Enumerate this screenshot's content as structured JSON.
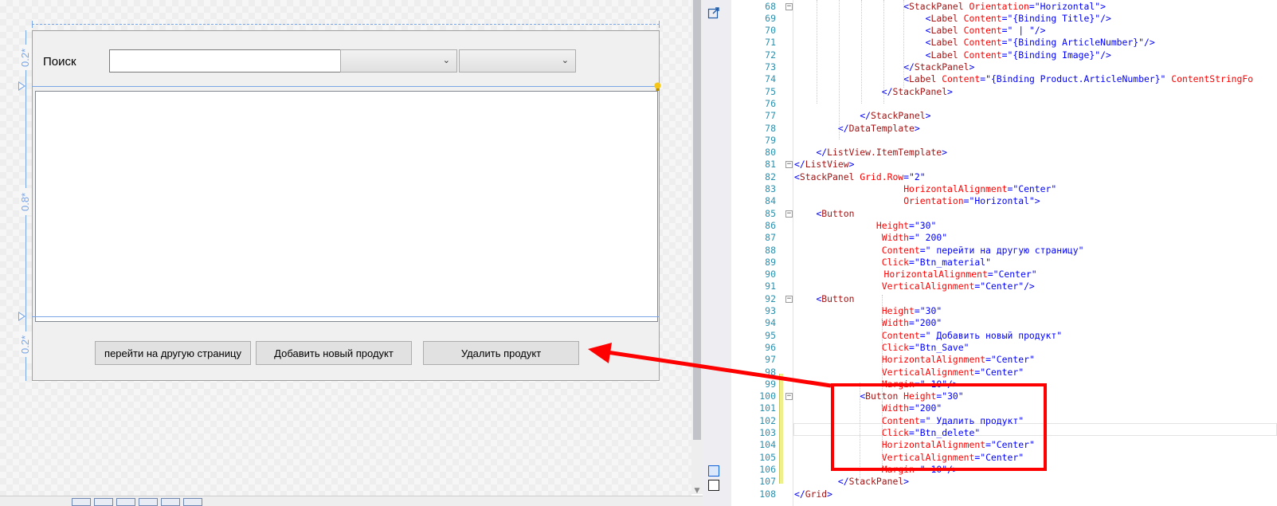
{
  "designer": {
    "row_labels": [
      "0.2*",
      "0.8*",
      "0.2*"
    ],
    "search_label": "Поиск",
    "search_input_value": "",
    "combo_1_value": "",
    "combo_2_value": "",
    "buttons": [
      "перейти на другую страницу",
      "Добавить новый продукт",
      "Удалить продукт"
    ],
    "icons": {
      "chevron": "⌄"
    }
  },
  "editor": {
    "lines": [
      {
        "n": 68,
        "tokens": [
          [
            "d",
            "<"
          ],
          [
            "e",
            "StackPanel"
          ],
          [
            "a",
            " Orientation"
          ],
          [
            "d",
            "=\""
          ],
          [
            "v",
            "Horizontal"
          ],
          [
            "d",
            "\">"
          ]
        ]
      },
      {
        "n": 69,
        "tokens": [
          [
            "d",
            "<"
          ],
          [
            "e",
            "Label"
          ],
          [
            "a",
            " Content"
          ],
          [
            "d",
            "=\""
          ],
          [
            "v",
            "{Binding Title}"
          ],
          [
            "d",
            "\"/>"
          ]
        ]
      },
      {
        "n": 70,
        "tokens": [
          [
            "d",
            "<"
          ],
          [
            "e",
            "Label"
          ],
          [
            "a",
            " Content"
          ],
          [
            "d",
            "=\""
          ],
          [
            "v",
            " | "
          ],
          [
            "d",
            "\"/>"
          ]
        ]
      },
      {
        "n": 71,
        "tokens": [
          [
            "d",
            "<"
          ],
          [
            "e",
            "Label"
          ],
          [
            "a",
            " Content"
          ],
          [
            "d",
            "=\""
          ],
          [
            "v",
            "{Binding ArticleNumber}"
          ],
          [
            "d",
            "\"/>"
          ]
        ]
      },
      {
        "n": 72,
        "tokens": [
          [
            "d",
            "<"
          ],
          [
            "e",
            "Label"
          ],
          [
            "a",
            " Content"
          ],
          [
            "d",
            "=\""
          ],
          [
            "v",
            "{Binding Image}"
          ],
          [
            "d",
            "\"/>"
          ]
        ]
      },
      {
        "n": 73,
        "tokens": [
          [
            "d",
            "</"
          ],
          [
            "e",
            "StackPanel"
          ],
          [
            "d",
            ">"
          ]
        ]
      },
      {
        "n": 74,
        "tokens": [
          [
            "d",
            "<"
          ],
          [
            "e",
            "Label"
          ],
          [
            "a",
            " Content"
          ],
          [
            "d",
            "=\""
          ],
          [
            "v",
            "{Binding Product.ArticleNumber}"
          ],
          [
            "d",
            "\""
          ],
          [
            "a",
            " ContentStringFo"
          ]
        ]
      },
      {
        "n": 75,
        "tokens": [
          [
            "d",
            "</"
          ],
          [
            "e",
            "StackPanel"
          ],
          [
            "d",
            ">"
          ]
        ]
      },
      {
        "n": 76,
        "tokens": []
      },
      {
        "n": 77,
        "tokens": [
          [
            "d",
            "</"
          ],
          [
            "e",
            "StackPanel"
          ],
          [
            "d",
            ">"
          ]
        ]
      },
      {
        "n": 78,
        "tokens": [
          [
            "d",
            "</"
          ],
          [
            "e",
            "DataTemplate"
          ],
          [
            "d",
            ">"
          ]
        ]
      },
      {
        "n": 79,
        "tokens": []
      },
      {
        "n": 80,
        "tokens": [
          [
            "d",
            "</"
          ],
          [
            "e",
            "ListView.ItemTemplate"
          ],
          [
            "d",
            ">"
          ]
        ]
      },
      {
        "n": 81,
        "tokens": [
          [
            "d",
            "</"
          ],
          [
            "e",
            "ListView"
          ],
          [
            "d",
            ">"
          ]
        ]
      },
      {
        "n": 82,
        "tokens": [
          [
            "d",
            "<"
          ],
          [
            "e",
            "StackPanel"
          ],
          [
            "a",
            " Grid.Row"
          ],
          [
            "d",
            "=\""
          ],
          [
            "v",
            "2"
          ],
          [
            "d",
            "\""
          ]
        ]
      },
      {
        "n": 83,
        "tokens": [
          [
            "a",
            "HorizontalAlignment"
          ],
          [
            "d",
            "=\""
          ],
          [
            "v",
            "Center"
          ],
          [
            "d",
            "\""
          ]
        ]
      },
      {
        "n": 84,
        "tokens": [
          [
            "a",
            "Orientation"
          ],
          [
            "d",
            "=\""
          ],
          [
            "v",
            "Horizontal"
          ],
          [
            "d",
            "\">"
          ]
        ]
      },
      {
        "n": 85,
        "tokens": [
          [
            "d",
            "<"
          ],
          [
            "e",
            "Button"
          ]
        ]
      },
      {
        "n": 86,
        "tokens": [
          [
            "a",
            "Height"
          ],
          [
            "d",
            "=\""
          ],
          [
            "v",
            "30"
          ],
          [
            "d",
            "\""
          ]
        ]
      },
      {
        "n": 87,
        "tokens": [
          [
            "a",
            "Width"
          ],
          [
            "d",
            "=\""
          ],
          [
            "v",
            " 200"
          ],
          [
            "d",
            "\""
          ]
        ]
      },
      {
        "n": 88,
        "tokens": [
          [
            "a",
            "Content"
          ],
          [
            "d",
            "=\""
          ],
          [
            "v",
            " перейти на другую страницу"
          ],
          [
            "d",
            "\""
          ]
        ]
      },
      {
        "n": 89,
        "tokens": [
          [
            "a",
            "Click"
          ],
          [
            "d",
            "=\""
          ],
          [
            "v",
            "Btn_material"
          ],
          [
            "d",
            "\""
          ]
        ]
      },
      {
        "n": 90,
        "tokens": [
          [
            "a",
            "HorizontalAlignment"
          ],
          [
            "d",
            "=\""
          ],
          [
            "v",
            "Center"
          ],
          [
            "d",
            "\""
          ]
        ]
      },
      {
        "n": 91,
        "tokens": [
          [
            "a",
            "VerticalAlignment"
          ],
          [
            "d",
            "=\""
          ],
          [
            "v",
            "Center"
          ],
          [
            "d",
            "\"/>"
          ]
        ]
      },
      {
        "n": 92,
        "tokens": [
          [
            "d",
            "<"
          ],
          [
            "e",
            "Button"
          ]
        ]
      },
      {
        "n": 93,
        "tokens": [
          [
            "a",
            "Height"
          ],
          [
            "d",
            "=\""
          ],
          [
            "v",
            "30"
          ],
          [
            "d",
            "\""
          ]
        ]
      },
      {
        "n": 94,
        "tokens": [
          [
            "a",
            "Width"
          ],
          [
            "d",
            "=\""
          ],
          [
            "v",
            "200"
          ],
          [
            "d",
            "\""
          ]
        ]
      },
      {
        "n": 95,
        "tokens": [
          [
            "a",
            "Content"
          ],
          [
            "d",
            "=\""
          ],
          [
            "v",
            " Добавить новый продукт"
          ],
          [
            "d",
            "\""
          ]
        ]
      },
      {
        "n": 96,
        "tokens": [
          [
            "a",
            "Click"
          ],
          [
            "d",
            "=\""
          ],
          [
            "v",
            "Btn_Save"
          ],
          [
            "d",
            "\""
          ]
        ]
      },
      {
        "n": 97,
        "tokens": [
          [
            "a",
            "HorizontalAlignment"
          ],
          [
            "d",
            "=\""
          ],
          [
            "v",
            "Center"
          ],
          [
            "d",
            "\""
          ]
        ]
      },
      {
        "n": 98,
        "tokens": [
          [
            "a",
            "VerticalAlignment"
          ],
          [
            "d",
            "=\""
          ],
          [
            "v",
            "Center"
          ],
          [
            "d",
            "\""
          ]
        ]
      },
      {
        "n": 99,
        "tokens": [
          [
            "a",
            "Margin"
          ],
          [
            "d",
            "=\""
          ],
          [
            "v",
            " 10"
          ],
          [
            "d",
            "\"/>"
          ]
        ]
      },
      {
        "n": 100,
        "tokens": [
          [
            "d",
            "<"
          ],
          [
            "e",
            "Button"
          ],
          [
            "a",
            " Height"
          ],
          [
            "d",
            "=\""
          ],
          [
            "v",
            "30"
          ],
          [
            "d",
            "\""
          ]
        ]
      },
      {
        "n": 101,
        "tokens": [
          [
            "a",
            "Width"
          ],
          [
            "d",
            "=\""
          ],
          [
            "v",
            "200"
          ],
          [
            "d",
            "\""
          ]
        ]
      },
      {
        "n": 102,
        "tokens": [
          [
            "a",
            "Content"
          ],
          [
            "d",
            "=\""
          ],
          [
            "v",
            " Удалить продукт"
          ],
          [
            "d",
            "\""
          ]
        ]
      },
      {
        "n": 103,
        "tokens": [
          [
            "a",
            "Click"
          ],
          [
            "d",
            "=\""
          ],
          [
            "v",
            "Btn_delete"
          ],
          [
            "d",
            "\""
          ]
        ]
      },
      {
        "n": 104,
        "tokens": [
          [
            "a",
            "HorizontalAlignment"
          ],
          [
            "d",
            "=\""
          ],
          [
            "v",
            "Center"
          ],
          [
            "d",
            "\""
          ]
        ]
      },
      {
        "n": 105,
        "tokens": [
          [
            "a",
            "VerticalAlignment"
          ],
          [
            "d",
            "=\""
          ],
          [
            "v",
            "Center"
          ],
          [
            "d",
            "\""
          ]
        ]
      },
      {
        "n": 106,
        "tokens": [
          [
            "a",
            "Margin"
          ],
          [
            "d",
            "=\""
          ],
          [
            "v",
            " 10"
          ],
          [
            "d",
            "\"/>"
          ]
        ]
      },
      {
        "n": 107,
        "tokens": [
          [
            "d",
            "</"
          ],
          [
            "e",
            "StackPanel"
          ],
          [
            "d",
            ">"
          ]
        ]
      },
      {
        "n": 108,
        "tokens": [
          [
            "d",
            "</"
          ],
          [
            "e",
            "Grid"
          ],
          [
            "d",
            ">"
          ]
        ]
      }
    ]
  },
  "colors": {
    "annotation": "#ff0000",
    "selection": "#7aa6e6",
    "xml_delimiter": "#0000ff",
    "xml_element": "#a31515",
    "xml_attribute": "#ff0000",
    "line_number": "#2b91af"
  }
}
